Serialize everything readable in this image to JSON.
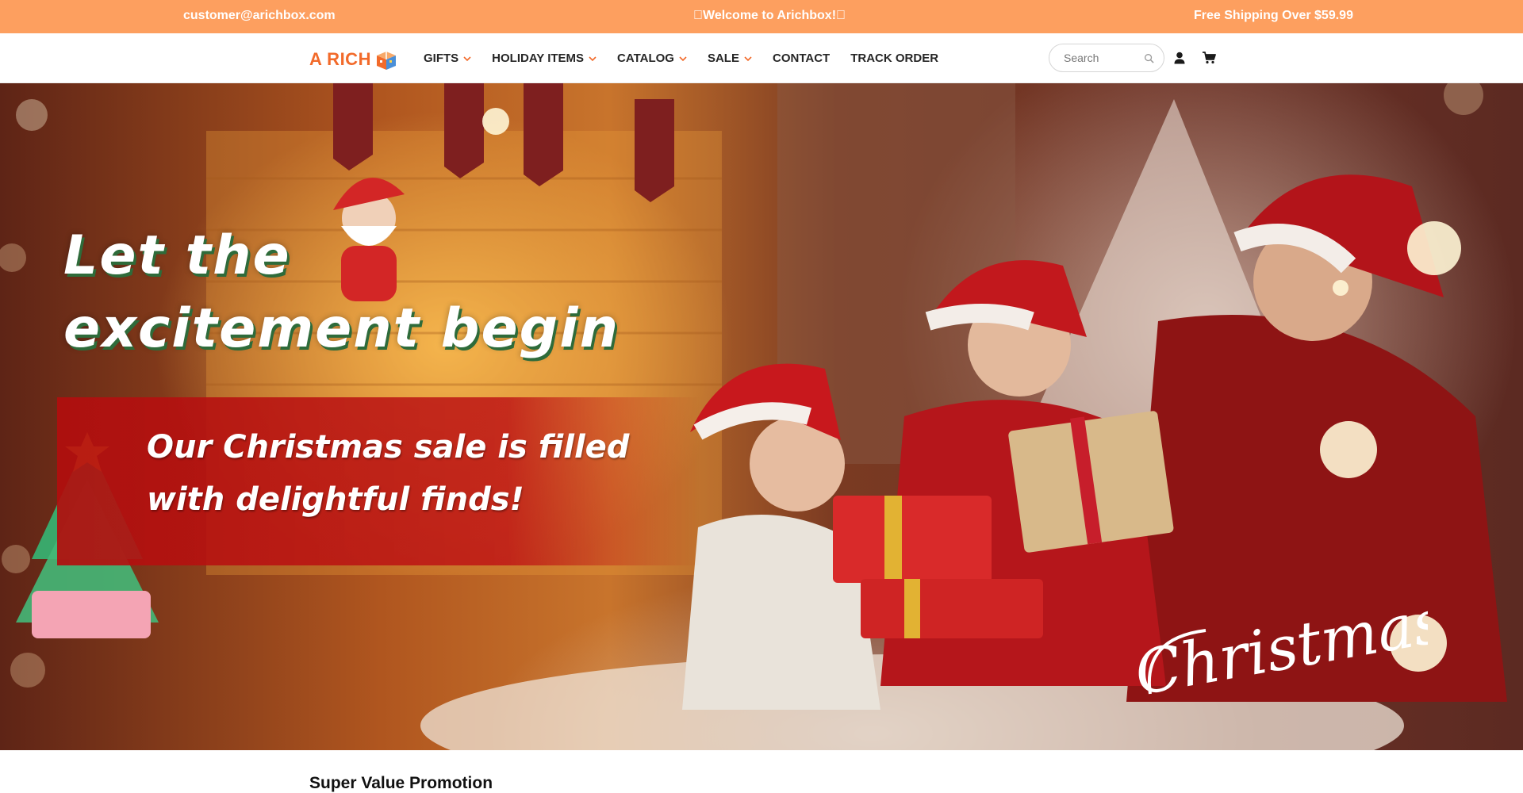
{
  "topbar": {
    "email": "customer@arichbox.com",
    "welcome": "\u0000Welcome to Arichbox!\u0000",
    "shipping": "Free Shipping Over $59.99"
  },
  "header": {
    "logo_text": "A RICH",
    "nav": [
      {
        "label": "GIFTS",
        "dropdown": true
      },
      {
        "label": "HOLIDAY ITEMS",
        "dropdown": true
      },
      {
        "label": "CATALOG",
        "dropdown": true
      },
      {
        "label": "SALE",
        "dropdown": true
      },
      {
        "label": "CONTACT",
        "dropdown": false
      },
      {
        "label": "TRACK ORDER",
        "dropdown": false
      }
    ],
    "search_placeholder": "Search",
    "icons": [
      "search-icon",
      "user-icon",
      "cart-icon"
    ]
  },
  "hero": {
    "headline_line1": "Let the",
    "headline_line2": "excitement begin",
    "subline_line1": "Our Christmas sale is filled",
    "subline_line2": "with delightful finds!",
    "script_text": "Christmas"
  },
  "section": {
    "title": "Super Value Promotion"
  },
  "colors": {
    "topbar": "#fd9f5f",
    "brand": "#f26a2a",
    "nav_text": "#262626",
    "banner_red": "#b20e0e",
    "headline_shadow": "#2e6b3a"
  }
}
